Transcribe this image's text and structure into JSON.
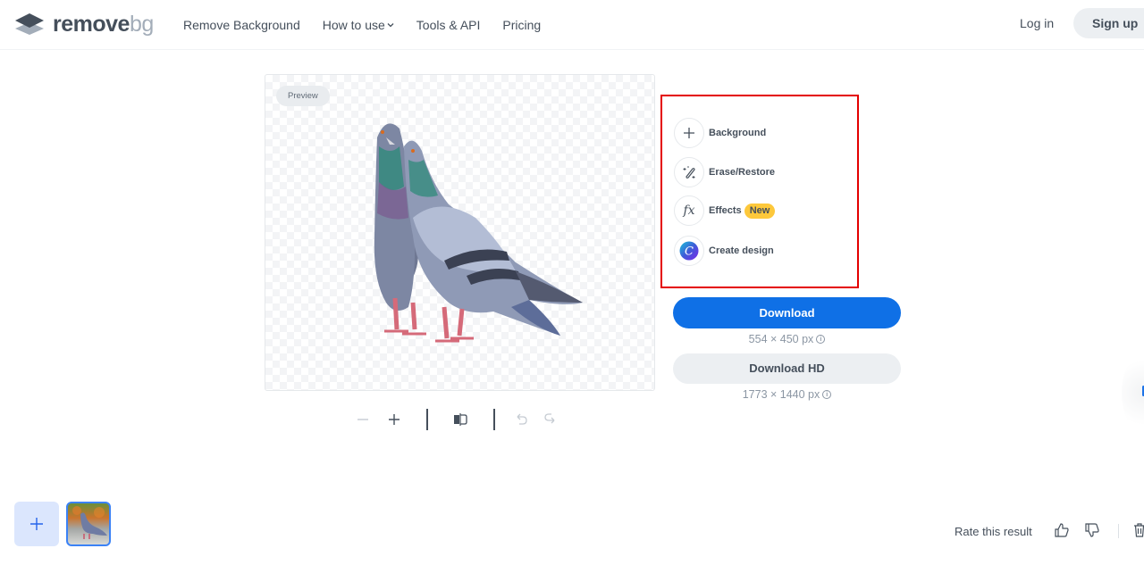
{
  "header": {
    "logo": {
      "primary": "remove",
      "secondary": "bg",
      "icon": "layers-logo-icon"
    },
    "nav": [
      {
        "label": "Remove Background"
      },
      {
        "label": "How to use",
        "has_dropdown": true,
        "dropdown_icon": "chevron-down-icon"
      },
      {
        "label": "Tools & API"
      },
      {
        "label": "Pricing"
      }
    ],
    "login_label": "Log in",
    "signup_label": "Sign up"
  },
  "preview": {
    "badge": "Preview",
    "image_description": "Two pigeons with transparent background"
  },
  "viewer_toolbar": {
    "zoom_out_icon": "minus-icon",
    "zoom_in_icon": "plus-icon",
    "compare_icon": "compare-icon",
    "undo_icon": "undo-icon",
    "redo_icon": "redo-icon"
  },
  "tools": [
    {
      "label": "Background",
      "icon": "plus-icon"
    },
    {
      "label": "Erase/Restore",
      "icon": "magic-brush-icon"
    },
    {
      "label": "Effects",
      "icon": "fx-icon",
      "badge": "New"
    },
    {
      "label": "Create design",
      "icon": "canva-icon"
    }
  ],
  "download": {
    "label": "Download",
    "size": "554 × 450 px",
    "hd_label": "Download HD",
    "hd_size": "1773 × 1440 px",
    "info_icon": "info-icon"
  },
  "footer": {
    "add_icon": "plus-icon",
    "rate_label": "Rate this result",
    "thumbs_up_icon": "thumbs-up-icon",
    "thumbs_down_icon": "thumbs-down-icon",
    "delete_icon": "trash-icon"
  },
  "colors": {
    "primary": "#0f70e6",
    "highlight_border": "#e40000",
    "new_badge": "#fdc83b",
    "text": "#454f5b"
  }
}
